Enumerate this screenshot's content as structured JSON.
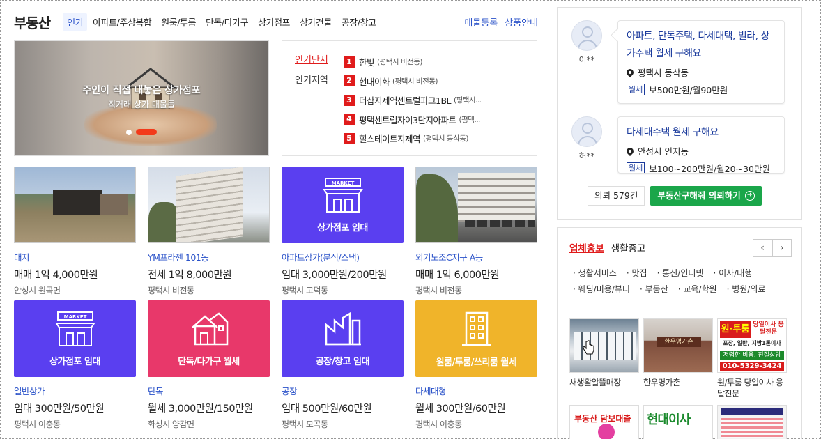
{
  "header": {
    "title": "부동산",
    "tabs": [
      "인기",
      "아파트/주상복합",
      "원룸/투룸",
      "단독/다가구",
      "상가점포",
      "상가건물",
      "공장/창고"
    ],
    "links": [
      "매물등록",
      "상품안내"
    ]
  },
  "banner": {
    "headline": "주인이 직접 내놓은 상가점포",
    "subline": "직거래 상가 매물들"
  },
  "ranking": {
    "categories": [
      "인기단지",
      "인기지역"
    ],
    "items": [
      {
        "num": "1",
        "name": "한빛",
        "loc": "(평택시 비전동)"
      },
      {
        "num": "2",
        "name": "현대이화",
        "loc": "(평택시 비전동)"
      },
      {
        "num": "3",
        "name": "더샵지제역센트럴파크1BL",
        "loc": "(평택시..."
      },
      {
        "num": "4",
        "name": "평택센트럴자이3단지아파트",
        "loc": "(평택..."
      },
      {
        "num": "5",
        "name": "힐스테이트지제역",
        "loc": "(평택시 동삭동)"
      }
    ]
  },
  "listings": [
    {
      "tile": "",
      "type": "대지",
      "price_pre": "매매 1억 ",
      "price_num": "4,000",
      "price_post": "만원",
      "loc": "안성시 원곡면"
    },
    {
      "tile": "",
      "type": "YM프라젠 101동",
      "price_pre": "전세 1억 ",
      "price_num": "8,000",
      "price_post": "만원",
      "loc": "평택시 비전동"
    },
    {
      "tile": "상가점포 임대",
      "type": "아파트상가(분식/스낵)",
      "price_pre": "임대 ",
      "price_num": "3,000만원/200",
      "price_post": "만원",
      "loc": "평택시 고덕동"
    },
    {
      "tile": "",
      "type": "외기노조C지구 A동",
      "price_pre": "매매 1억 ",
      "price_num": "6,000",
      "price_post": "만원",
      "loc": "평택시 비전동"
    },
    {
      "tile": "상가점포 임대",
      "type": "일반상가",
      "price_pre": "임대 ",
      "price_num": "300만원/50",
      "price_post": "만원",
      "loc": "평택시 이충동"
    },
    {
      "tile": "단독/다가구 월세",
      "type": "단독",
      "price_pre": "월세 ",
      "price_num": "3,000만원/150",
      "price_post": "만원",
      "loc": "화성시 양감면"
    },
    {
      "tile": "공장/창고 임대",
      "type": "공장",
      "price_pre": "임대 ",
      "price_num": "500만원/60",
      "price_post": "만원",
      "loc": "평택시 모곡동"
    },
    {
      "tile": "원룸/투룸/쓰리룸 월세",
      "type": "다세대형",
      "price_pre": "월세 ",
      "price_num": "300만원/60",
      "price_post": "만원",
      "loc": "평택시 이충동"
    }
  ],
  "tile_market_label": "MARKET",
  "requests": [
    {
      "nick": "이**",
      "title": "아파트, 단독주택, 다세대택, 빌라, 상가주택 월세 구해요",
      "loc": "평택시 동삭동",
      "badge": "월세",
      "price": "보500만원/월90만원"
    },
    {
      "nick": "허**",
      "title": "다세대주택 월세 구해요",
      "loc": "안성시 인지동",
      "badge": "월세",
      "price": "보100~200만원/월20~30만원"
    }
  ],
  "request_footer": {
    "count": "의뢰 579건",
    "button": "부동산구해줘 의뢰하기"
  },
  "promo": {
    "tabs": [
      "업체홍보",
      "생활중고"
    ],
    "prev": "‹",
    "next": "›",
    "categories": [
      "생활서비스",
      "맛집",
      "통신/인터넷",
      "이사/대행",
      "웨딩/미용/뷰티",
      "부동산",
      "교육/학원",
      "병원/의료"
    ],
    "ads": [
      {
        "caption": "새생활알뜰매장"
      },
      {
        "caption": "한우명가촌",
        "sign": "한우명가촌"
      },
      {
        "caption": "원/투룸 당일이사 용달전문",
        "red": "원·투룸",
        "side": "당일이사 용달전문",
        "mid": "포장, 일반, 지방1톤이사",
        "green": "저렴한 비용, 친절상담",
        "phone": "010-5329-3424"
      }
    ],
    "ads_bottom": [
      {
        "text": "부동산 담보대출"
      },
      {
        "text": "현대이사"
      },
      {
        "text": ""
      }
    ]
  },
  "colors": {
    "accent_blue": "#2a52c9",
    "accent_red": "#e01b1b",
    "green": "#1aa64a",
    "tile_purple": "#5a3ff0",
    "tile_pink": "#e8386a",
    "tile_yellow": "#f0b42a"
  }
}
